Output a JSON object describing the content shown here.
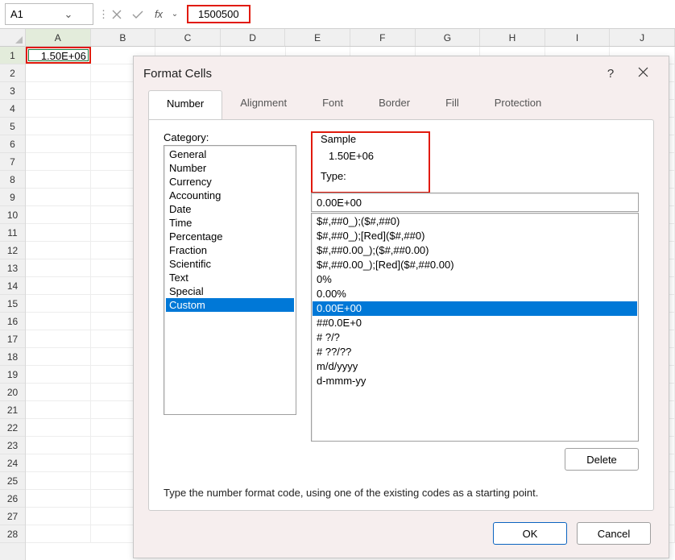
{
  "formula_bar": {
    "name_box": "A1",
    "fx_label": "fx",
    "value": "1500500"
  },
  "columns": [
    "A",
    "B",
    "C",
    "D",
    "E",
    "F",
    "G",
    "H",
    "I",
    "J"
  ],
  "rows": [
    "1",
    "2",
    "3",
    "4",
    "5",
    "6",
    "7",
    "8",
    "9",
    "10",
    "11",
    "12",
    "13",
    "14",
    "15",
    "16",
    "17",
    "18",
    "19",
    "20",
    "21",
    "22",
    "23",
    "24",
    "25",
    "26",
    "27",
    "28"
  ],
  "a1_value": "1.50E+06",
  "dialog": {
    "title": "Format Cells",
    "tabs": {
      "number": "Number",
      "alignment": "Alignment",
      "font": "Font",
      "border": "Border",
      "fill": "Fill",
      "protection": "Protection"
    },
    "category_label": "Category:",
    "categories": [
      "General",
      "Number",
      "Currency",
      "Accounting",
      "Date",
      "Time",
      "Percentage",
      "Fraction",
      "Scientific",
      "Text",
      "Special",
      "Custom"
    ],
    "sample_label": "Sample",
    "sample_value": "1.50E+06",
    "type_label": "Type:",
    "type_value": "0.00E+00",
    "format_list": [
      "$#,##0_);($#,##0)",
      "$#,##0_);[Red]($#,##0)",
      "$#,##0.00_);($#,##0.00)",
      "$#,##0.00_);[Red]($#,##0.00)",
      "0%",
      "0.00%",
      "0.00E+00",
      "##0.0E+0",
      "# ?/?",
      "# ??/??",
      "m/d/yyyy",
      "d-mmm-yy"
    ],
    "delete_label": "Delete",
    "footer_text": "Type the number format code, using one of the existing codes as a starting point.",
    "ok_label": "OK",
    "cancel_label": "Cancel"
  }
}
